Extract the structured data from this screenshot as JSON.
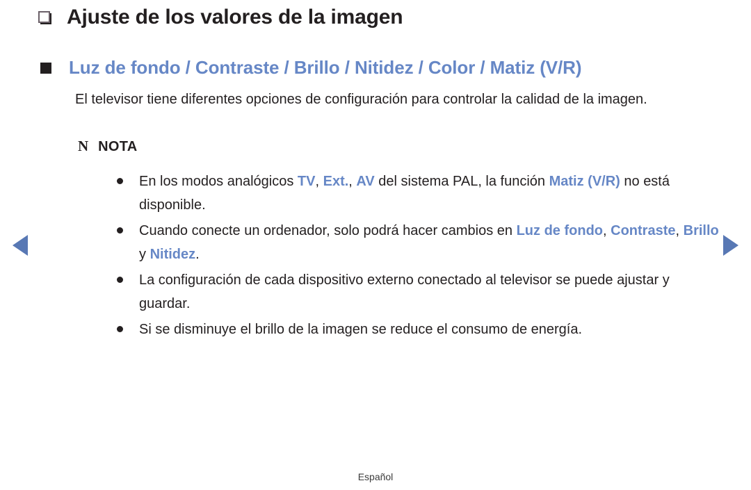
{
  "document": {
    "title": "Ajuste de los valores de la imagen",
    "title_icon": "page-square-icon",
    "subtitle": "Luz de fondo / Contraste / Brillo / Nitidez / Color / Matiz (V/R)",
    "subtitle_icon": "filled-square-bullet-icon",
    "body_paragraph": "El televisor tiene diferentes opciones de configuración para controlar la calidad de la imagen.",
    "note": {
      "glyph": "N",
      "label": "NOTA",
      "items": [
        {
          "segments": [
            {
              "text": "En los modos analógicos ",
              "highlight": false
            },
            {
              "text": "TV",
              "highlight": true
            },
            {
              "text": ", ",
              "highlight": false
            },
            {
              "text": "Ext.",
              "highlight": true
            },
            {
              "text": ", ",
              "highlight": false
            },
            {
              "text": "AV",
              "highlight": true
            },
            {
              "text": " del sistema PAL, la función ",
              "highlight": false
            },
            {
              "text": "Matiz (V/R)",
              "highlight": true
            },
            {
              "text": " no está disponible.",
              "highlight": false
            }
          ]
        },
        {
          "segments": [
            {
              "text": "Cuando conecte un ordenador, solo podrá hacer cambios en ",
              "highlight": false
            },
            {
              "text": "Luz de fondo",
              "highlight": true
            },
            {
              "text": ", ",
              "highlight": false
            },
            {
              "text": "Contraste",
              "highlight": true
            },
            {
              "text": ", ",
              "highlight": false
            },
            {
              "text": "Brillo",
              "highlight": true
            },
            {
              "text": " y ",
              "highlight": false
            },
            {
              "text": "Nitidez",
              "highlight": true
            },
            {
              "text": ".",
              "highlight": false
            }
          ]
        },
        {
          "segments": [
            {
              "text": "La configuración de cada dispositivo externo conectado al televisor se puede ajustar y guardar.",
              "highlight": false
            }
          ]
        },
        {
          "segments": [
            {
              "text": "Si se disminuye el brillo de la imagen se reduce el consumo de energía.",
              "highlight": false
            }
          ]
        }
      ]
    }
  },
  "navigation": {
    "prev_icon": "triangle-left-icon",
    "next_icon": "triangle-right-icon"
  },
  "footer": {
    "language": "Español"
  },
  "colors": {
    "accent_blue": "#6687c6",
    "arrow_blue": "#5878b4",
    "text": "#231f20",
    "background": "#ffffff"
  }
}
